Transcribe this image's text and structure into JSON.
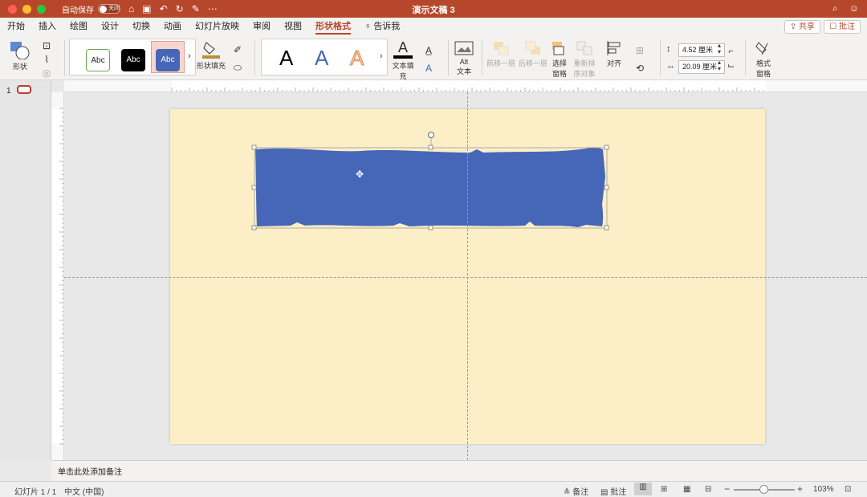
{
  "titlebar": {
    "autosave_label": "自动保存",
    "autosave_state": "关闭",
    "doc_title": "演示文稿 3"
  },
  "menu": {
    "tabs": [
      "开始",
      "插入",
      "绘图",
      "设计",
      "切换",
      "动画",
      "幻灯片放映",
      "审阅",
      "视图",
      "形状格式"
    ],
    "active_tab": "形状格式",
    "tell_me": "告诉我",
    "share": "共享",
    "comments": "批注"
  },
  "ribbon": {
    "shapes_label": "形状",
    "style_samples": [
      "Abc",
      "Abc",
      "Abc"
    ],
    "shape_fill_label": "形状填充",
    "text_fill_label": "文本填充",
    "alt_text_label_1": "Alt",
    "alt_text_label_2": "文本",
    "bring_forward": "前移一层",
    "send_backward": "后移一层",
    "selection_pane_1": "选择",
    "selection_pane_2": "窗格",
    "reorder_1": "重新排",
    "reorder_2": "序对象",
    "align": "对齐",
    "height_value": "4.52 厘米",
    "width_value": "20.09 厘米",
    "format_pane_1": "格式",
    "format_pane_2": "窗格",
    "wordart_letter": "A",
    "colors": {
      "accent": "#b7472a",
      "shape_blue": "#4666b7",
      "slide_bg": "#fcefc7"
    }
  },
  "slides": {
    "thumb_number": "1"
  },
  "notes": {
    "placeholder": "单击此处添加备注"
  },
  "status": {
    "slide_count": "幻灯片 1 / 1",
    "language": "中文 (中国)",
    "notes": "备注",
    "comments": "批注",
    "zoom": "103%"
  }
}
